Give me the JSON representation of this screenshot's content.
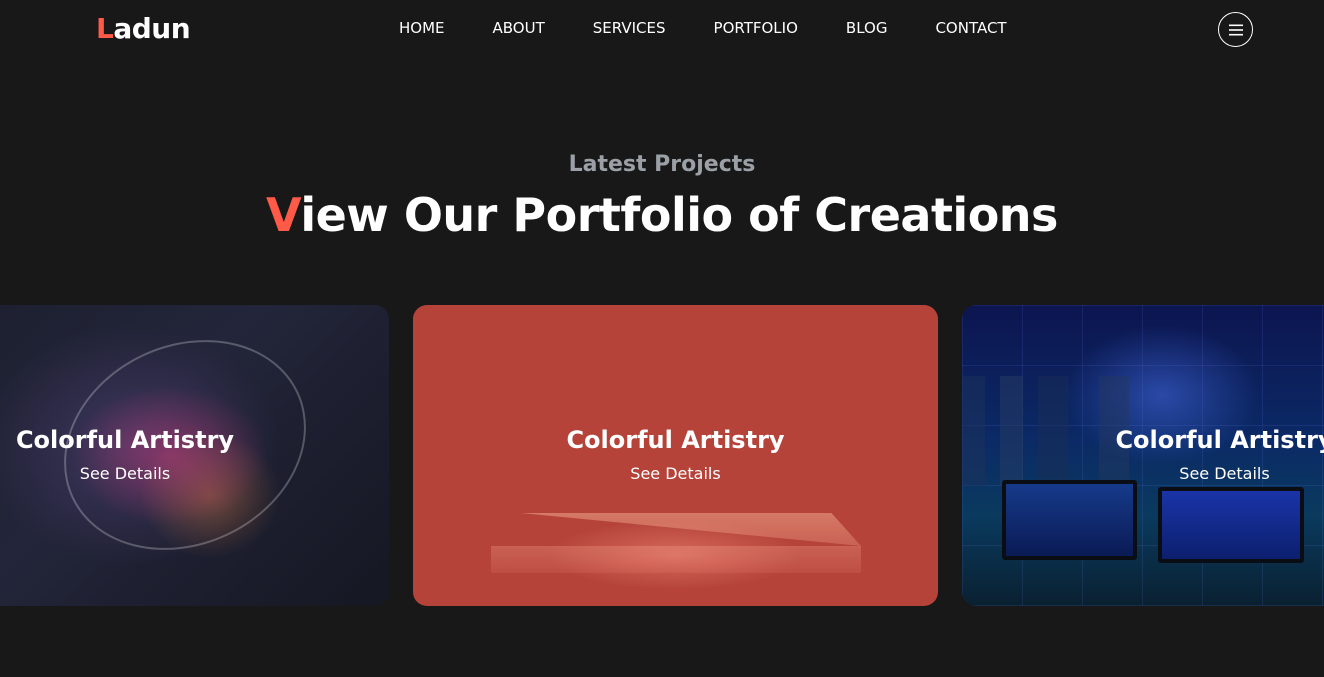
{
  "header": {
    "logo_first": "L",
    "logo_rest": "adun",
    "nav": [
      "HOME",
      "ABOUT",
      "SERVICES",
      "PORTFOLIO",
      "BLOG",
      "CONTACT"
    ],
    "menu_icon": "hamburger-icon"
  },
  "section": {
    "subtitle": "Latest Projects",
    "title_first": "V",
    "title_rest": "iew Our Portfolio of Creations"
  },
  "cards": [
    {
      "title": "Colorful Artistry",
      "link": "See Details"
    },
    {
      "title": "Colorful Artistry",
      "link": "See Details"
    },
    {
      "title": "Colorful Artistry",
      "link": "See Details"
    }
  ],
  "colors": {
    "accent": "#ff5a47",
    "background": "#181818",
    "subtitle": "#9aa0a6",
    "card_overlay": "#b5433a"
  }
}
